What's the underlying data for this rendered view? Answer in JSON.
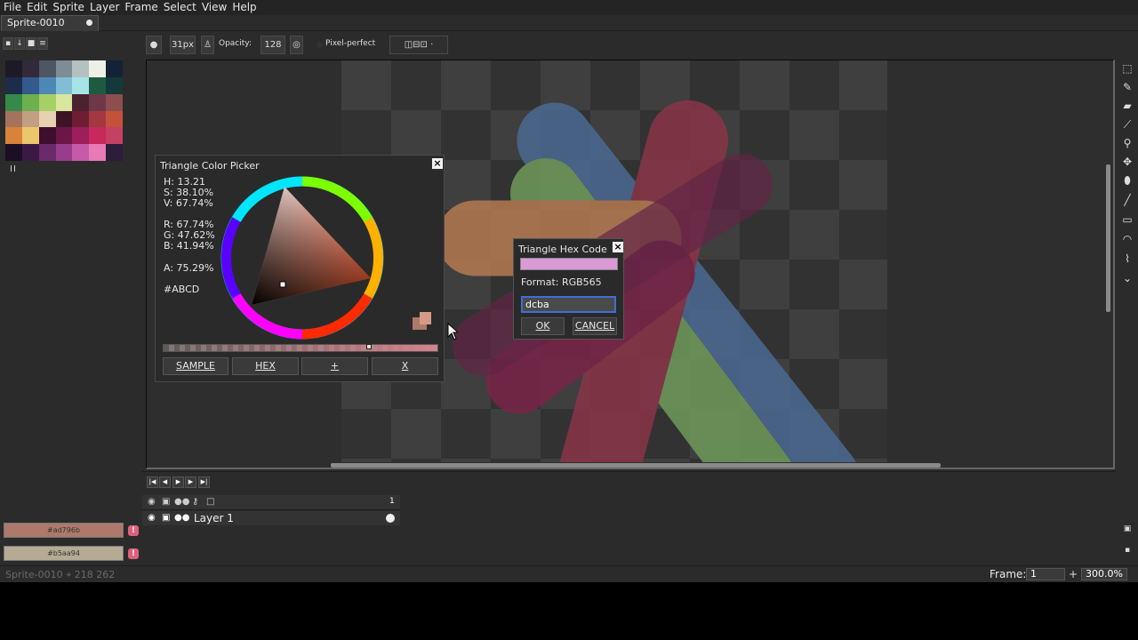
{
  "menu": [
    "File",
    "Edit",
    "Sprite",
    "Layer",
    "Frame",
    "Select",
    "View",
    "Help"
  ],
  "tab": {
    "label": "Sprite-0010"
  },
  "palette": {
    "colors": [
      "#1c1a24",
      "#322a3a",
      "#4e5662",
      "#7e8c96",
      "#b5c1c0",
      "#eef0e6",
      "#142237",
      "#1c2c4a",
      "#345a8c",
      "#4c88b6",
      "#82bdd6",
      "#a6e4e6",
      "#1c5b42",
      "#13393a",
      "#358a48",
      "#6cb050",
      "#a6d064",
      "#d8e69e",
      "#4a2230",
      "#6e3848",
      "#8c4e4e",
      "#a4735c",
      "#c29e82",
      "#e6d2ae",
      "#3c1426",
      "#6e1e32",
      "#a23842",
      "#c45238",
      "#d8823c",
      "#ecc66c",
      "#3e0e2e",
      "#6c1648",
      "#9c1e5a",
      "#c8285c",
      "#c44064",
      "#1a0f24",
      "#3a1a44",
      "#6a2a6a",
      "#9a3c8c",
      "#c65aa8",
      "#e87ab8",
      "#2d1c3c"
    ],
    "fg_hex": "#ad796b",
    "bg_hex": "#b5aa94"
  },
  "context_bar": {
    "brush_size": "31px",
    "opacity_label": "Opacity:",
    "opacity_value": "128",
    "pixel_perfect_label": "Pixel-perfect"
  },
  "color_picker": {
    "title": "Triangle Color Picker",
    "h": "H: 13.21",
    "s": "S: 38.10%",
    "v": "V: 67.74%",
    "r": "R: 67.74%",
    "g": "G: 47.62%",
    "b": "B: 41.94%",
    "a": "A: 75.29%",
    "hex": "#ABCD",
    "buttons": {
      "sample": "SAMPLE",
      "hex": "HEX",
      "plus": "+",
      "close": "X"
    }
  },
  "hex_dialog": {
    "title": "Triangle Hex Code",
    "format": "Format: RGB565",
    "input_value": "dcba",
    "ok": "OK",
    "cancel": "CANCEL",
    "preview_color": "#dc9ad6"
  },
  "timeline": {
    "frame_number": "1",
    "layer_name": "Layer 1"
  },
  "status": {
    "sprite": "Sprite-0010",
    "coords": "218 262",
    "frame_label": "Frame:",
    "frame_value": "1",
    "zoom": "300.0%"
  }
}
